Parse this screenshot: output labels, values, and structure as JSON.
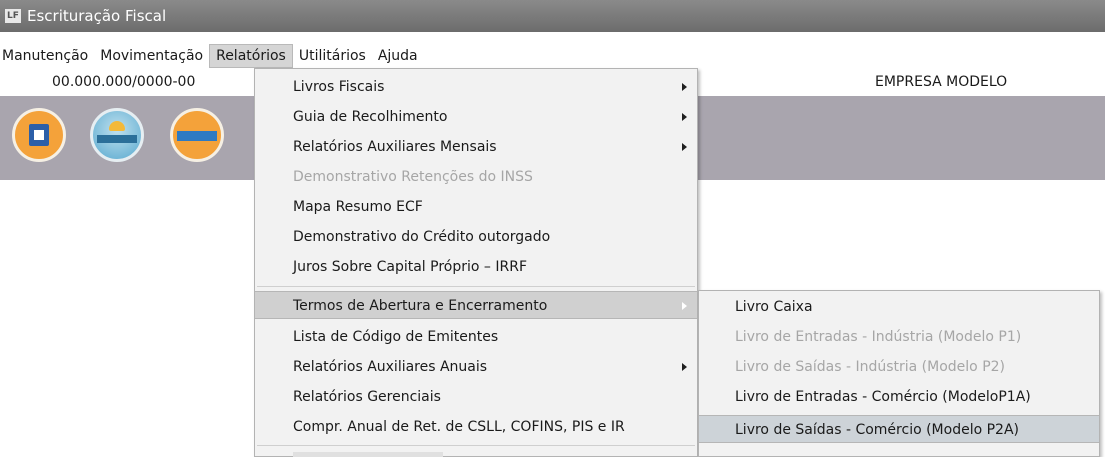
{
  "window": {
    "title": "Escrituração Fiscal",
    "icon": "app-icon"
  },
  "menubar": [
    "Manutenção",
    "Movimentação",
    "Relatórios",
    "Utilitários",
    "Ajuda"
  ],
  "info": {
    "cnpj": "00.000.000/0000-00",
    "empresa": "EMPRESA MODELO"
  },
  "toolbar_icons": [
    "building-icon",
    "sped-contribuicoes-icon",
    "icms-ipi-icon"
  ],
  "relatorios_menu": [
    {
      "label": "Livros Fiscais",
      "submenu": true
    },
    {
      "label": "Guia de Recolhimento",
      "submenu": true
    },
    {
      "label": "Relatórios Auxiliares Mensais",
      "submenu": true
    },
    {
      "label": "Demonstrativo Retenções do INSS",
      "disabled": true
    },
    {
      "label": "Mapa Resumo ECF"
    },
    {
      "label": "Demonstrativo do Crédito outorgado"
    },
    {
      "label": "Juros Sobre Capital Próprio – IRRF"
    },
    {
      "label": "Termos de Abertura e Encerramento",
      "submenu": true,
      "highlighted": true
    },
    {
      "label": "Lista de Código de Emitentes"
    },
    {
      "label": "Relatórios Auxiliares Anuais",
      "submenu": true
    },
    {
      "label": "Relatórios Gerenciais"
    },
    {
      "label": "Compr. Anual de Ret. de CSLL, COFINS,  PIS e IR"
    }
  ],
  "termos_submenu": [
    {
      "label": "Livro Caixa"
    },
    {
      "label": "Livro de Entradas - Indústria (Modelo P1)",
      "disabled": true
    },
    {
      "label": "Livro de Saídas - Indústria (Modelo P2)",
      "disabled": true
    },
    {
      "label": "Livro de Entradas - Comércio (ModeloP1A)"
    },
    {
      "label": "Livro de Saídas - Comércio (Modelo P2A)",
      "highlighted": true
    }
  ]
}
